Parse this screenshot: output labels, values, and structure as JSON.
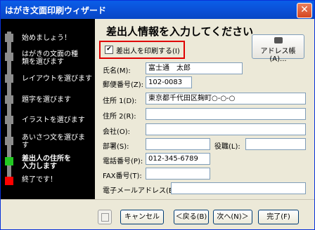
{
  "window": {
    "title": "はがき文面印刷ウィザード",
    "close": "✕"
  },
  "sidebar": {
    "steps": [
      {
        "label": "始めましょう！"
      },
      {
        "label": "はがきの文面の種類を選びます",
        "line1": "はがきの文面の種",
        "line2": "類を選びます"
      },
      {
        "label": "レイアウトを選びます"
      },
      {
        "label": "題字を選びます"
      },
      {
        "label": "イラストを選びます"
      },
      {
        "label": "あいさつ文を選びます",
        "line1": "あいさつ文を選びま",
        "line2": "す"
      },
      {
        "label": "差出人の住所を入力します",
        "line1": "差出人の住所を",
        "line2": "入力します",
        "current": true
      },
      {
        "label": "終了です！"
      }
    ]
  },
  "main": {
    "heading": "差出人情報を入力してください",
    "address_book_button": "アドレス帳(A)...",
    "print_sender_checkbox": {
      "label": "差出人を印刷する(I)",
      "checked": true,
      "mark": "✔"
    },
    "fields": {
      "name": {
        "label": "氏名(M):",
        "value": "富士通　太郎"
      },
      "zip": {
        "label": "郵便番号(Z):",
        "value": "102-0083"
      },
      "address1": {
        "label": "住所 1(D):",
        "value": "東京都千代田区麹町○-○-○"
      },
      "address2": {
        "label": "住所 2(R):",
        "value": ""
      },
      "company": {
        "label": "会社(O):",
        "value": ""
      },
      "department": {
        "label": "部署(S):",
        "value": ""
      },
      "position": {
        "label": "役職(L):",
        "value": ""
      },
      "phone": {
        "label": "電話番号(P):",
        "value": "012-345-6789"
      },
      "fax": {
        "label": "FAX番号(T):",
        "value": ""
      },
      "email": {
        "label": "電子メールアドレス(E):",
        "value": ""
      }
    }
  },
  "buttons": {
    "cancel": "キャンセル",
    "back": "＜戻る(B)",
    "next": "次へ(N)＞",
    "finish": "完了(F)"
  },
  "colors": {
    "title_bar": "#0a4fd6",
    "highlight_border": "#e00000",
    "current_step_marker": "#22c822",
    "end_marker": "#ff0000"
  }
}
